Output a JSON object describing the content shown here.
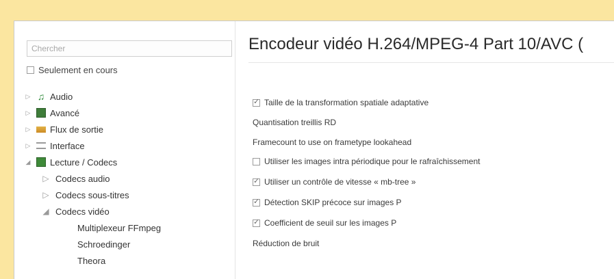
{
  "search": {
    "placeholder": "Chercher"
  },
  "only_current": {
    "label": "Seulement en cours",
    "checked": false
  },
  "tree": {
    "items": [
      {
        "label": "Audio",
        "icon": "music-note-icon",
        "expander": "▷"
      },
      {
        "label": "Avancé",
        "icon": "advanced-icon",
        "expander": "▷"
      },
      {
        "label": "Flux de sortie",
        "icon": "output-stream-icon",
        "expander": "▷"
      },
      {
        "label": "Interface",
        "icon": "interface-icon",
        "expander": "▷"
      },
      {
        "label": "Lecture / Codecs",
        "icon": "codecs-icon",
        "expander": "◢"
      },
      {
        "label": "Codecs audio",
        "bullet": "▷"
      },
      {
        "label": "Codecs sous-titres",
        "bullet": "▷"
      },
      {
        "label": "Codecs vidéo",
        "bullet": "◢"
      },
      {
        "label": "Multiplexeur FFmpeg"
      },
      {
        "label": "Schroedinger"
      },
      {
        "label": "Theora"
      }
    ]
  },
  "panel": {
    "title": "Encodeur vidéo H.264/MPEG-4 Part 10/AVC (",
    "options": [
      {
        "label": "Taille de la transformation spatiale adaptative",
        "checkbox": true,
        "checked": true
      },
      {
        "label": "Quantisation treillis RD",
        "checkbox": false
      },
      {
        "label": "Framecount to use on frametype lookahead",
        "checkbox": false
      },
      {
        "label": "Utiliser les images intra périodique pour le rafraîchissement",
        "checkbox": true,
        "checked": false
      },
      {
        "label": "Utiliser un contrôle de vitesse « mb-tree »",
        "checkbox": true,
        "checked": true
      },
      {
        "label": "Détection SKIP précoce sur images P",
        "checkbox": true,
        "checked": true
      },
      {
        "label": "Coefficient de seuil sur les images P",
        "checkbox": true,
        "checked": true
      },
      {
        "label": "Réduction de bruit",
        "checkbox": false
      }
    ]
  }
}
